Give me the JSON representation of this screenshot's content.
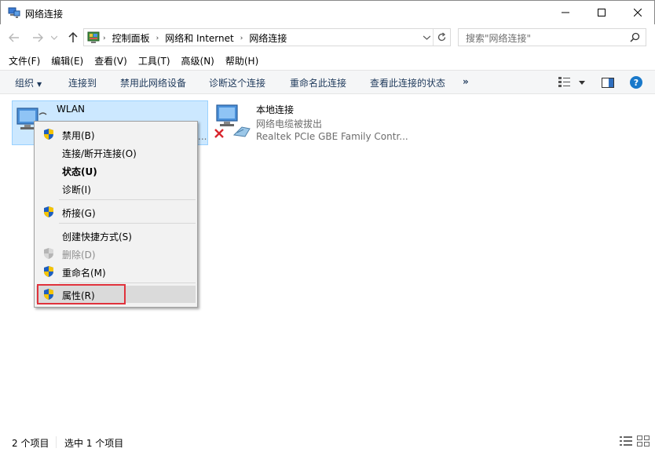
{
  "window": {
    "title": "网络连接",
    "minimize": "—",
    "maximize": "☐",
    "close": "✕"
  },
  "address": {
    "crumbs": [
      "控制面板",
      "网络和 Internet",
      "网络连接"
    ],
    "search_placeholder": "搜索\"网络连接\""
  },
  "menu": [
    "文件(F)",
    "编辑(E)",
    "查看(V)",
    "工具(T)",
    "高级(N)",
    "帮助(H)"
  ],
  "commands": {
    "organize": "组织",
    "connect_to": "连接到",
    "disable_device": "禁用此网络设备",
    "diagnose": "诊断这个连接",
    "rename": "重命名此连接",
    "view_status": "查看此连接的状态",
    "more": "»"
  },
  "items": [
    {
      "name": "WLAN",
      "sub1": "...",
      "sub2": "..."
    },
    {
      "name": "本地连接",
      "status": "网络电缆被拔出",
      "adapter": "Realtek PCIe GBE Family Contr..."
    }
  ],
  "context_menu": {
    "disable": "禁用(B)",
    "connect_disconnect": "连接/断开连接(O)",
    "status": "状态(U)",
    "diagnose": "诊断(I)",
    "bridge": "桥接(G)",
    "create_shortcut": "创建快捷方式(S)",
    "delete": "删除(D)",
    "rename": "重命名(M)",
    "properties": "属性(R)"
  },
  "status": {
    "count": "2 个项目",
    "selected": "选中 1 个项目"
  },
  "colors": {
    "selection_bg": "#cce8ff",
    "selection_border": "#99d1ff",
    "highlight_red": "#e0323c",
    "help_blue": "#1979ca"
  }
}
